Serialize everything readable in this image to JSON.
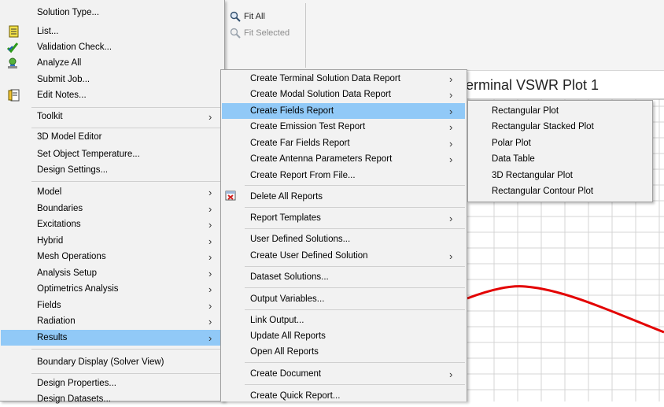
{
  "toolbar": {
    "fit_all": "Fit All",
    "fit_selected": "Fit Selected"
  },
  "plot": {
    "title": "erminal VSWR Plot 1",
    "curve_color": "#e30000"
  },
  "menu1": {
    "solution_type": "Solution Type...",
    "list": "List...",
    "validation_check": "Validation Check...",
    "analyze_all": "Analyze All",
    "submit_job": "Submit Job...",
    "edit_notes": "Edit Notes...",
    "toolkit": "Toolkit",
    "model_editor": "3D Model Editor",
    "set_object_temperature": "Set Object Temperature...",
    "design_settings": "Design Settings...",
    "model": "Model",
    "boundaries": "Boundaries",
    "excitations": "Excitations",
    "hybrid": "Hybrid",
    "mesh_operations": "Mesh Operations",
    "analysis_setup": "Analysis Setup",
    "optimetrics_analysis": "Optimetrics Analysis",
    "fields": "Fields",
    "radiation": "Radiation",
    "results": "Results",
    "boundary_display": "Boundary Display (Solver View)",
    "design_properties": "Design Properties...",
    "design_datasets": "Design Datasets..."
  },
  "menu2": {
    "terminal_solution_report": "Create Terminal Solution Data Report",
    "modal_solution_report": "Create Modal Solution Data Report",
    "fields_report": "Create Fields Report",
    "emission_test_report": "Create Emission Test Report",
    "far_fields_report": "Create Far Fields Report",
    "antenna_params_report": "Create Antenna Parameters Report",
    "report_from_file": "Create Report From File...",
    "delete_all_reports": "Delete All Reports",
    "report_templates": "Report Templates",
    "user_defined_solutions": "User Defined Solutions...",
    "create_user_defined_solution": "Create User Defined Solution",
    "dataset_solutions": "Dataset Solutions...",
    "output_variables": "Output Variables...",
    "link_output": "Link Output...",
    "update_all_reports": "Update All Reports",
    "open_all_reports": "Open All Reports",
    "create_document": "Create Document",
    "create_quick_report": "Create Quick Report..."
  },
  "menu3": {
    "rectangular_plot": "Rectangular Plot",
    "rectangular_stacked_plot": "Rectangular Stacked Plot",
    "polar_plot": "Polar Plot",
    "data_table": "Data Table",
    "rectangular_3d_plot": "3D Rectangular Plot",
    "rectangular_contour_plot": "Rectangular Contour Plot"
  },
  "colors": {
    "menu_bg": "#f2f2f2",
    "highlight": "#91c9f7",
    "separator": "#d0d0d0"
  }
}
